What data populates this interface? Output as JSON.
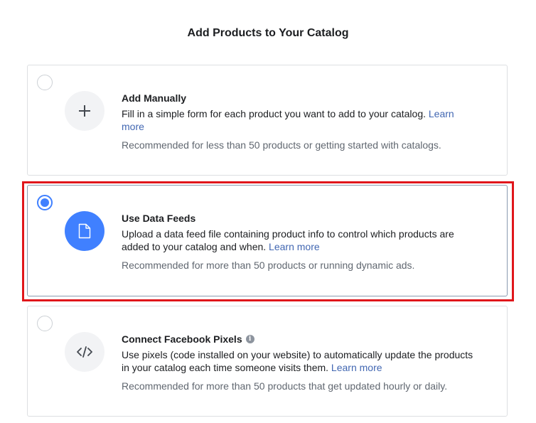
{
  "page": {
    "title": "Add Products to Your Catalog"
  },
  "options": [
    {
      "title": "Add Manually",
      "description": "Fill in a simple form for each product you want to add to your catalog.",
      "link": "Learn more",
      "recommendation": "Recommended for less than 50 products or getting started with catalogs.",
      "icon": "plus-icon",
      "selected": false
    },
    {
      "title": "Use Data Feeds",
      "description": "Upload a data feed file containing product info to control which products are added to your catalog and when.",
      "link": "Learn more",
      "recommendation": "Recommended for more than 50 products or running dynamic ads.",
      "icon": "document-icon",
      "selected": true
    },
    {
      "title": "Connect Facebook Pixels",
      "info_icon": "info-icon",
      "description": "Use pixels (code installed on your website) to automatically update the products in your catalog each time someone visits them.",
      "link": "Learn more",
      "recommendation": "Recommended for more than 50 products that get updated hourly or daily.",
      "icon": "code-icon",
      "selected": false
    }
  ],
  "colors": {
    "accent": "#4080ff",
    "link": "#4267b2",
    "highlight": "#e0161b",
    "muted_text": "#606770",
    "border": "#dddfe2"
  }
}
